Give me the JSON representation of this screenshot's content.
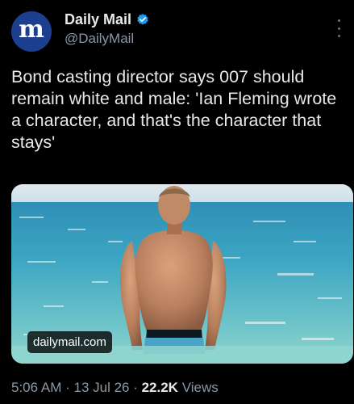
{
  "account": {
    "avatar_letter": "m",
    "display_name": "Daily Mail",
    "handle": "@DailyMail",
    "verified": true,
    "avatar_color": "#1c3f8f",
    "verified_color": "#1d9bf0"
  },
  "more_menu": {
    "icon": "more-vertical-icon"
  },
  "tweet": {
    "text": "Bond casting director says 007 should remain white and male: 'Ian Fleming wrote a character, and that's the character that stays'"
  },
  "media": {
    "domain": "dailymail.com"
  },
  "meta": {
    "time": "5:06 AM",
    "separator1": " · ",
    "date": "13 Jul 26",
    "separator2": " · ",
    "views_count": "22.2K",
    "views_label": " Views"
  }
}
